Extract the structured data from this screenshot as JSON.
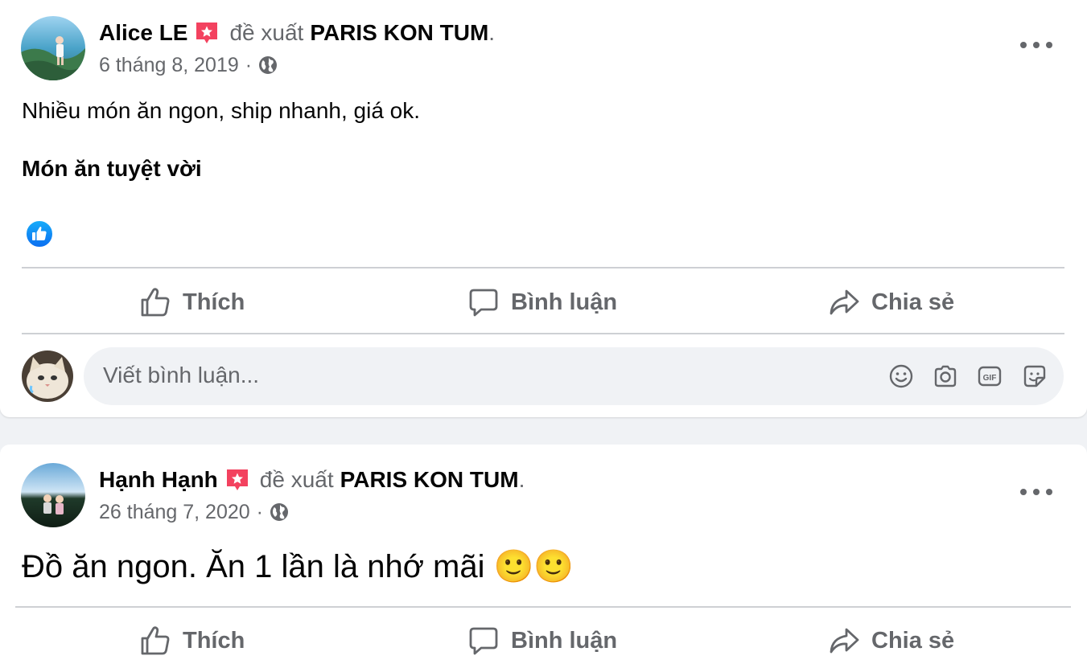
{
  "posts": [
    {
      "author": "Alice LE",
      "recommend_text": "đề xuất",
      "page": "PARIS KON TUM",
      "period": ".",
      "date": "6 tháng 8, 2019",
      "separator": "·",
      "text_line1": "Nhiều món ăn ngon, ship nhanh, giá ok.",
      "text_line2": "Món ăn tuyệt vời",
      "reaction_icon": "like-reaction-icon"
    },
    {
      "author": "Hạnh Hạnh",
      "recommend_text": "đề xuất",
      "page": "PARIS KON TUM",
      "period": ".",
      "date": "26 tháng 7, 2020",
      "separator": "·",
      "text_line1": "Đồ ăn ngon. Ăn 1 lần là nhớ mãi 🙂🙂"
    }
  ],
  "actions": {
    "like": "Thích",
    "comment": "Bình luận",
    "share": "Chia sẻ"
  },
  "comment_input": {
    "placeholder": "Viết bình luận..."
  },
  "colors": {
    "secondary_text": "#65676b",
    "like_blue": "#1877f2",
    "badge_red": "#f3425f",
    "divider": "#ced0d4"
  }
}
